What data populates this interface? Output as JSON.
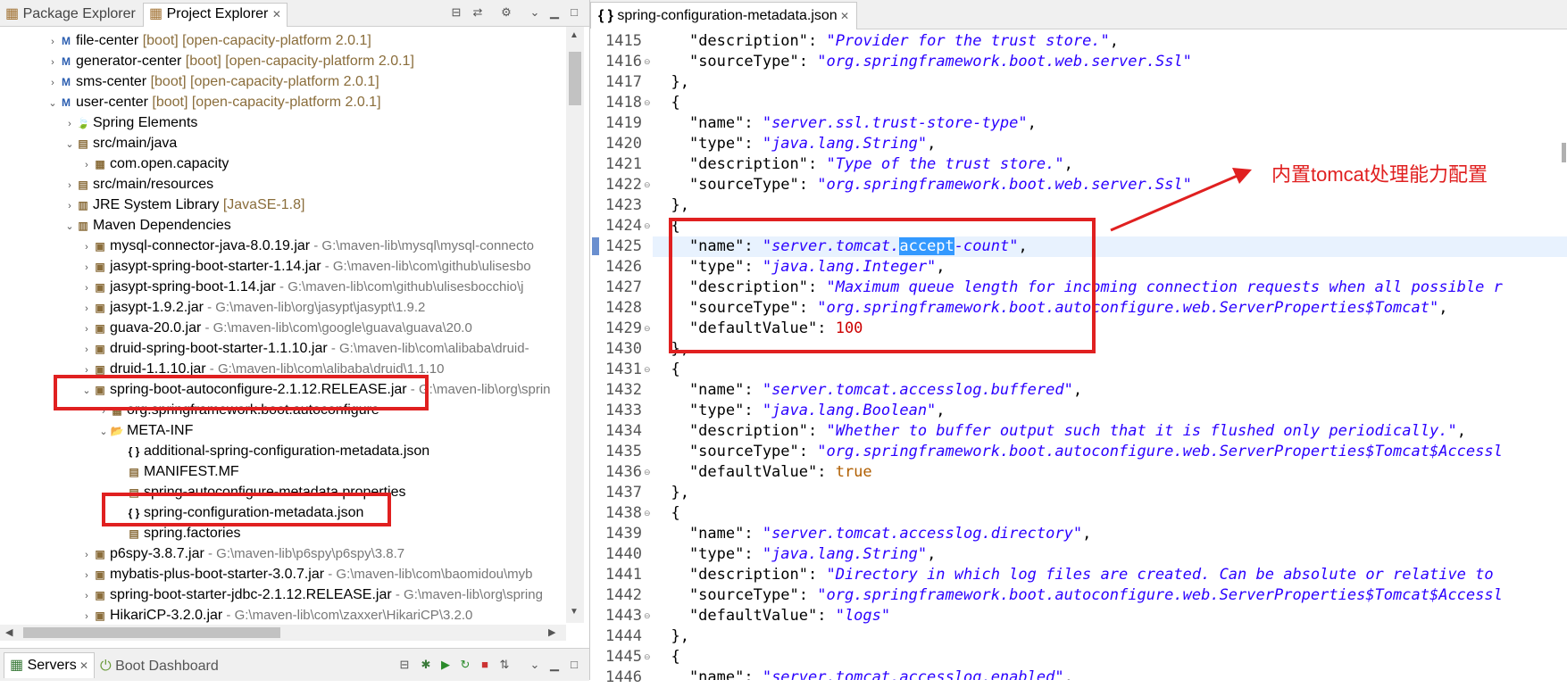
{
  "left_panel": {
    "tabs": [
      {
        "label": "Package Explorer"
      },
      {
        "label": "Project Explorer"
      }
    ],
    "tree": [
      {
        "indent": 0,
        "twisty": "›",
        "icon": "M",
        "label": "file-center",
        "decor": " [boot] [open-capacity-platform 2.0.1]",
        "path": ""
      },
      {
        "indent": 0,
        "twisty": "›",
        "icon": "M",
        "label": "generator-center",
        "decor": " [boot] [open-capacity-platform 2.0.1]",
        "path": ""
      },
      {
        "indent": 0,
        "twisty": "›",
        "icon": "M",
        "label": "sms-center",
        "decor": " [boot] [open-capacity-platform 2.0.1]",
        "path": ""
      },
      {
        "indent": 0,
        "twisty": "⌄",
        "icon": "M",
        "label": "user-center",
        "decor": " [boot] [open-capacity-platform 2.0.1]",
        "path": ""
      },
      {
        "indent": 1,
        "twisty": "›",
        "icon": "🍃",
        "label": "Spring Elements",
        "decor": "",
        "path": ""
      },
      {
        "indent": 1,
        "twisty": "⌄",
        "icon": "▤",
        "label": "src/main/java",
        "decor": "",
        "path": ""
      },
      {
        "indent": 2,
        "twisty": "›",
        "icon": "▦",
        "label": "com.open.capacity",
        "decor": "",
        "path": ""
      },
      {
        "indent": 1,
        "twisty": "›",
        "icon": "▤",
        "label": "src/main/resources",
        "decor": "",
        "path": ""
      },
      {
        "indent": 1,
        "twisty": "›",
        "icon": "▥",
        "label": "JRE System Library",
        "decor": " [JavaSE-1.8]",
        "path": ""
      },
      {
        "indent": 1,
        "twisty": "⌄",
        "icon": "▥",
        "label": "Maven Dependencies",
        "decor": "",
        "path": ""
      },
      {
        "indent": 2,
        "twisty": "›",
        "icon": "▣",
        "label": "mysql-connector-java-8.0.19.jar",
        "decor": "",
        "path": " - G:\\maven-lib\\mysql\\mysql-connecto"
      },
      {
        "indent": 2,
        "twisty": "›",
        "icon": "▣",
        "label": "jasypt-spring-boot-starter-1.14.jar",
        "decor": "",
        "path": " - G:\\maven-lib\\com\\github\\ulisesbo"
      },
      {
        "indent": 2,
        "twisty": "›",
        "icon": "▣",
        "label": "jasypt-spring-boot-1.14.jar",
        "decor": "",
        "path": " - G:\\maven-lib\\com\\github\\ulisesbocchio\\j"
      },
      {
        "indent": 2,
        "twisty": "›",
        "icon": "▣",
        "label": "jasypt-1.9.2.jar",
        "decor": "",
        "path": " - G:\\maven-lib\\org\\jasypt\\jasypt\\1.9.2"
      },
      {
        "indent": 2,
        "twisty": "›",
        "icon": "▣",
        "label": "guava-20.0.jar",
        "decor": "",
        "path": " - G:\\maven-lib\\com\\google\\guava\\guava\\20.0"
      },
      {
        "indent": 2,
        "twisty": "›",
        "icon": "▣",
        "label": "druid-spring-boot-starter-1.1.10.jar",
        "decor": "",
        "path": " - G:\\maven-lib\\com\\alibaba\\druid-"
      },
      {
        "indent": 2,
        "twisty": "›",
        "icon": "▣",
        "label": "druid-1.1.10.jar",
        "decor": "",
        "path": " - G:\\maven-lib\\com\\alibaba\\druid\\1.1.10"
      },
      {
        "indent": 2,
        "twisty": "⌄",
        "icon": "▣",
        "label": "spring-boot-autoconfigure-2.1.12.RELEASE.jar",
        "decor": "",
        "path": " - G:\\maven-lib\\org\\sprin"
      },
      {
        "indent": 3,
        "twisty": "›",
        "icon": "▦",
        "label": "org.springframework.boot.autoconfigure",
        "decor": "",
        "path": ""
      },
      {
        "indent": 3,
        "twisty": "⌄",
        "icon": "📂",
        "label": "META-INF",
        "decor": "",
        "path": ""
      },
      {
        "indent": 4,
        "twisty": "",
        "icon": "{ }",
        "label": "additional-spring-configuration-metadata.json",
        "decor": "",
        "path": ""
      },
      {
        "indent": 4,
        "twisty": "",
        "icon": "▤",
        "label": "MANIFEST.MF",
        "decor": "",
        "path": ""
      },
      {
        "indent": 4,
        "twisty": "",
        "icon": "▤",
        "label": "spring-autoconfigure-metadata.properties",
        "decor": "",
        "path": ""
      },
      {
        "indent": 4,
        "twisty": "",
        "icon": "{ }",
        "label": "spring-configuration-metadata.json",
        "decor": "",
        "path": ""
      },
      {
        "indent": 4,
        "twisty": "",
        "icon": "▤",
        "label": "spring.factories",
        "decor": "",
        "path": ""
      },
      {
        "indent": 2,
        "twisty": "›",
        "icon": "▣",
        "label": "p6spy-3.8.7.jar",
        "decor": "",
        "path": " - G:\\maven-lib\\p6spy\\p6spy\\3.8.7"
      },
      {
        "indent": 2,
        "twisty": "›",
        "icon": "▣",
        "label": "mybatis-plus-boot-starter-3.0.7.jar",
        "decor": "",
        "path": " - G:\\maven-lib\\com\\baomidou\\myb"
      },
      {
        "indent": 2,
        "twisty": "›",
        "icon": "▣",
        "label": "spring-boot-starter-jdbc-2.1.12.RELEASE.jar",
        "decor": "",
        "path": " - G:\\maven-lib\\org\\spring"
      },
      {
        "indent": 2,
        "twisty": "›",
        "icon": "▣",
        "label": "HikariCP-3.2.0.jar",
        "decor": "",
        "path": " - G:\\maven-lib\\com\\zaxxer\\HikariCP\\3.2.0"
      }
    ],
    "bottom_tabs": [
      {
        "label": "Servers"
      },
      {
        "label": "Boot Dashboard"
      }
    ]
  },
  "editor": {
    "tab_label": "spring-configuration-metadata.json",
    "current_line": "1425",
    "lines": [
      {
        "no": "1415",
        "fold": "",
        "parts": [
          [
            "k",
            "    \""
          ],
          [
            "k",
            "description"
          ],
          [
            "k",
            "\": "
          ],
          [
            "s",
            "\"Provider for the trust store.\""
          ],
          [
            "k",
            ","
          ]
        ]
      },
      {
        "no": "1416",
        "fold": "⊖",
        "parts": [
          [
            "k",
            "    \""
          ],
          [
            "k",
            "sourceType"
          ],
          [
            "k",
            "\": "
          ],
          [
            "s",
            "\"org.springframework.boot.web.server.Ssl\""
          ]
        ]
      },
      {
        "no": "1417",
        "fold": "",
        "parts": [
          [
            "k",
            "  },"
          ]
        ]
      },
      {
        "no": "1418",
        "fold": "⊖",
        "parts": [
          [
            "k",
            "  {"
          ]
        ]
      },
      {
        "no": "1419",
        "fold": "",
        "parts": [
          [
            "k",
            "    \"name\": "
          ],
          [
            "s",
            "\"server.ssl.trust-store-type\""
          ],
          [
            "k",
            ","
          ]
        ]
      },
      {
        "no": "1420",
        "fold": "",
        "parts": [
          [
            "k",
            "    \"type\": "
          ],
          [
            "s",
            "\"java.lang.String\""
          ],
          [
            "k",
            ","
          ]
        ]
      },
      {
        "no": "1421",
        "fold": "",
        "parts": [
          [
            "k",
            "    \"description\": "
          ],
          [
            "s",
            "\"Type of the trust store.\""
          ],
          [
            "k",
            ","
          ]
        ]
      },
      {
        "no": "1422",
        "fold": "⊖",
        "parts": [
          [
            "k",
            "    \"sourceType\": "
          ],
          [
            "s",
            "\"org.springframework.boot.web.server.Ssl\""
          ]
        ]
      },
      {
        "no": "1423",
        "fold": "",
        "parts": [
          [
            "k",
            "  },"
          ]
        ]
      },
      {
        "no": "1424",
        "fold": "⊖",
        "parts": [
          [
            "k",
            "  {"
          ]
        ]
      },
      {
        "no": "1425",
        "fold": "",
        "parts": [
          [
            "k",
            "    \"name\": "
          ],
          [
            "s",
            "\"server.tomcat."
          ],
          [
            "sel",
            "accept"
          ],
          [
            "s",
            "-count\""
          ],
          [
            "k",
            ","
          ]
        ]
      },
      {
        "no": "1426",
        "fold": "",
        "parts": [
          [
            "k",
            "    \"type\": "
          ],
          [
            "s",
            "\"java.lang.Integer\""
          ],
          [
            "k",
            ","
          ]
        ]
      },
      {
        "no": "1427",
        "fold": "",
        "parts": [
          [
            "k",
            "    \"description\": "
          ],
          [
            "s",
            "\"Maximum queue length for incoming connection requests when all possible r"
          ]
        ]
      },
      {
        "no": "1428",
        "fold": "",
        "parts": [
          [
            "k",
            "    \"sourceType\": "
          ],
          [
            "s",
            "\"org.springframework.boot.autoconfigure.web.ServerProperties$Tomcat\""
          ],
          [
            "k",
            ","
          ]
        ]
      },
      {
        "no": "1429",
        "fold": "⊖",
        "parts": [
          [
            "k",
            "    \"defaultValue\": "
          ],
          [
            "n",
            "100"
          ]
        ]
      },
      {
        "no": "1430",
        "fold": "",
        "parts": [
          [
            "k",
            "  },"
          ]
        ]
      },
      {
        "no": "1431",
        "fold": "⊖",
        "parts": [
          [
            "k",
            "  {"
          ]
        ]
      },
      {
        "no": "1432",
        "fold": "",
        "parts": [
          [
            "k",
            "    \"name\": "
          ],
          [
            "s",
            "\"server.tomcat.accesslog.buffered\""
          ],
          [
            "k",
            ","
          ]
        ]
      },
      {
        "no": "1433",
        "fold": "",
        "parts": [
          [
            "k",
            "    \"type\": "
          ],
          [
            "s",
            "\"java.lang.Boolean\""
          ],
          [
            "k",
            ","
          ]
        ]
      },
      {
        "no": "1434",
        "fold": "",
        "parts": [
          [
            "k",
            "    \"description\": "
          ],
          [
            "s",
            "\"Whether to buffer output such that it is flushed only periodically.\""
          ],
          [
            "k",
            ","
          ]
        ]
      },
      {
        "no": "1435",
        "fold": "",
        "parts": [
          [
            "k",
            "    \"sourceType\": "
          ],
          [
            "s",
            "\"org.springframework.boot.autoconfigure.web.ServerProperties$Tomcat$Accessl"
          ]
        ]
      },
      {
        "no": "1436",
        "fold": "⊖",
        "parts": [
          [
            "k",
            "    \"defaultValue\": "
          ],
          [
            "b",
            "true"
          ]
        ]
      },
      {
        "no": "1437",
        "fold": "",
        "parts": [
          [
            "k",
            "  },"
          ]
        ]
      },
      {
        "no": "1438",
        "fold": "⊖",
        "parts": [
          [
            "k",
            "  {"
          ]
        ]
      },
      {
        "no": "1439",
        "fold": "",
        "parts": [
          [
            "k",
            "    \"name\": "
          ],
          [
            "s",
            "\"server.tomcat.accesslog.directory\""
          ],
          [
            "k",
            ","
          ]
        ]
      },
      {
        "no": "1440",
        "fold": "",
        "parts": [
          [
            "k",
            "    \"type\": "
          ],
          [
            "s",
            "\"java.lang.String\""
          ],
          [
            "k",
            ","
          ]
        ]
      },
      {
        "no": "1441",
        "fold": "",
        "parts": [
          [
            "k",
            "    \"description\": "
          ],
          [
            "s",
            "\"Directory in which log files are created. Can be absolute or relative to"
          ]
        ]
      },
      {
        "no": "1442",
        "fold": "",
        "parts": [
          [
            "k",
            "    \"sourceType\": "
          ],
          [
            "s",
            "\"org.springframework.boot.autoconfigure.web.ServerProperties$Tomcat$Accessl"
          ]
        ]
      },
      {
        "no": "1443",
        "fold": "⊖",
        "parts": [
          [
            "k",
            "    \"defaultValue\": "
          ],
          [
            "s",
            "\"logs\""
          ]
        ]
      },
      {
        "no": "1444",
        "fold": "",
        "parts": [
          [
            "k",
            "  },"
          ]
        ]
      },
      {
        "no": "1445",
        "fold": "⊖",
        "parts": [
          [
            "k",
            "  {"
          ]
        ]
      },
      {
        "no": "1446",
        "fold": "",
        "parts": [
          [
            "k",
            "    \"name\": "
          ],
          [
            "s",
            "\"server.tomcat.accesslog.enabled\""
          ],
          [
            "k",
            ","
          ]
        ]
      }
    ]
  },
  "annotation": {
    "text": "内置tomcat处理能力配置",
    "color": "#e02020"
  }
}
